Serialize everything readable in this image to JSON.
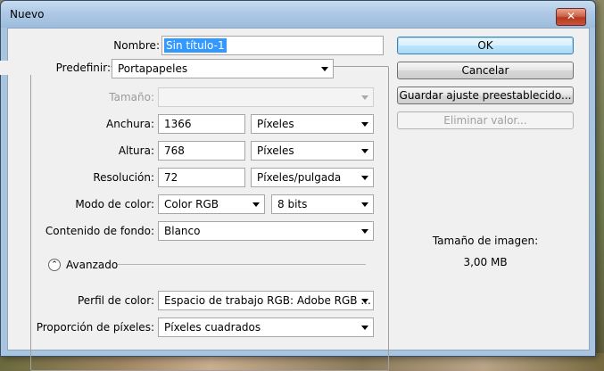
{
  "window": {
    "title": "Nuevo",
    "close_glyph": "✕"
  },
  "form": {
    "name_label": "Nombre:",
    "name_value": "Sin título-1",
    "preset_label": "Predefinir:",
    "preset_value": "Portapapeles",
    "size_label": "Tamaño:",
    "size_value": "",
    "width_label": "Anchura:",
    "width_value": "1366",
    "width_unit": "Píxeles",
    "height_label": "Altura:",
    "height_value": "768",
    "height_unit": "Píxeles",
    "resolution_label": "Resolución:",
    "resolution_value": "72",
    "resolution_unit": "Píxeles/pulgada",
    "color_mode_label": "Modo de color:",
    "color_mode_value": "Color RGB",
    "bit_depth_value": "8 bits",
    "background_label": "Contenido de fondo:",
    "background_value": "Blanco",
    "advanced_label": "Avanzado",
    "advanced_glyph": "⌃",
    "color_profile_label": "Perfil de color:",
    "color_profile_value": "Espacio de trabajo RGB: Adobe RGB ...",
    "pixel_ratio_label": "Proporción de píxeles:",
    "pixel_ratio_value": "Píxeles cuadrados"
  },
  "buttons": {
    "ok": "OK",
    "cancel": "Cancelar",
    "save_preset": "Guardar ajuste preestablecido...",
    "delete_preset": "Eliminar valor..."
  },
  "info": {
    "image_size_label": "Tamaño de imagen:",
    "image_size_value": "3,00 MB"
  },
  "colors": {
    "selection": "#3399ff",
    "title_bar": "#aec9e6",
    "dialog_bg": "#f0f0f0",
    "close_button": "#c9553c"
  }
}
